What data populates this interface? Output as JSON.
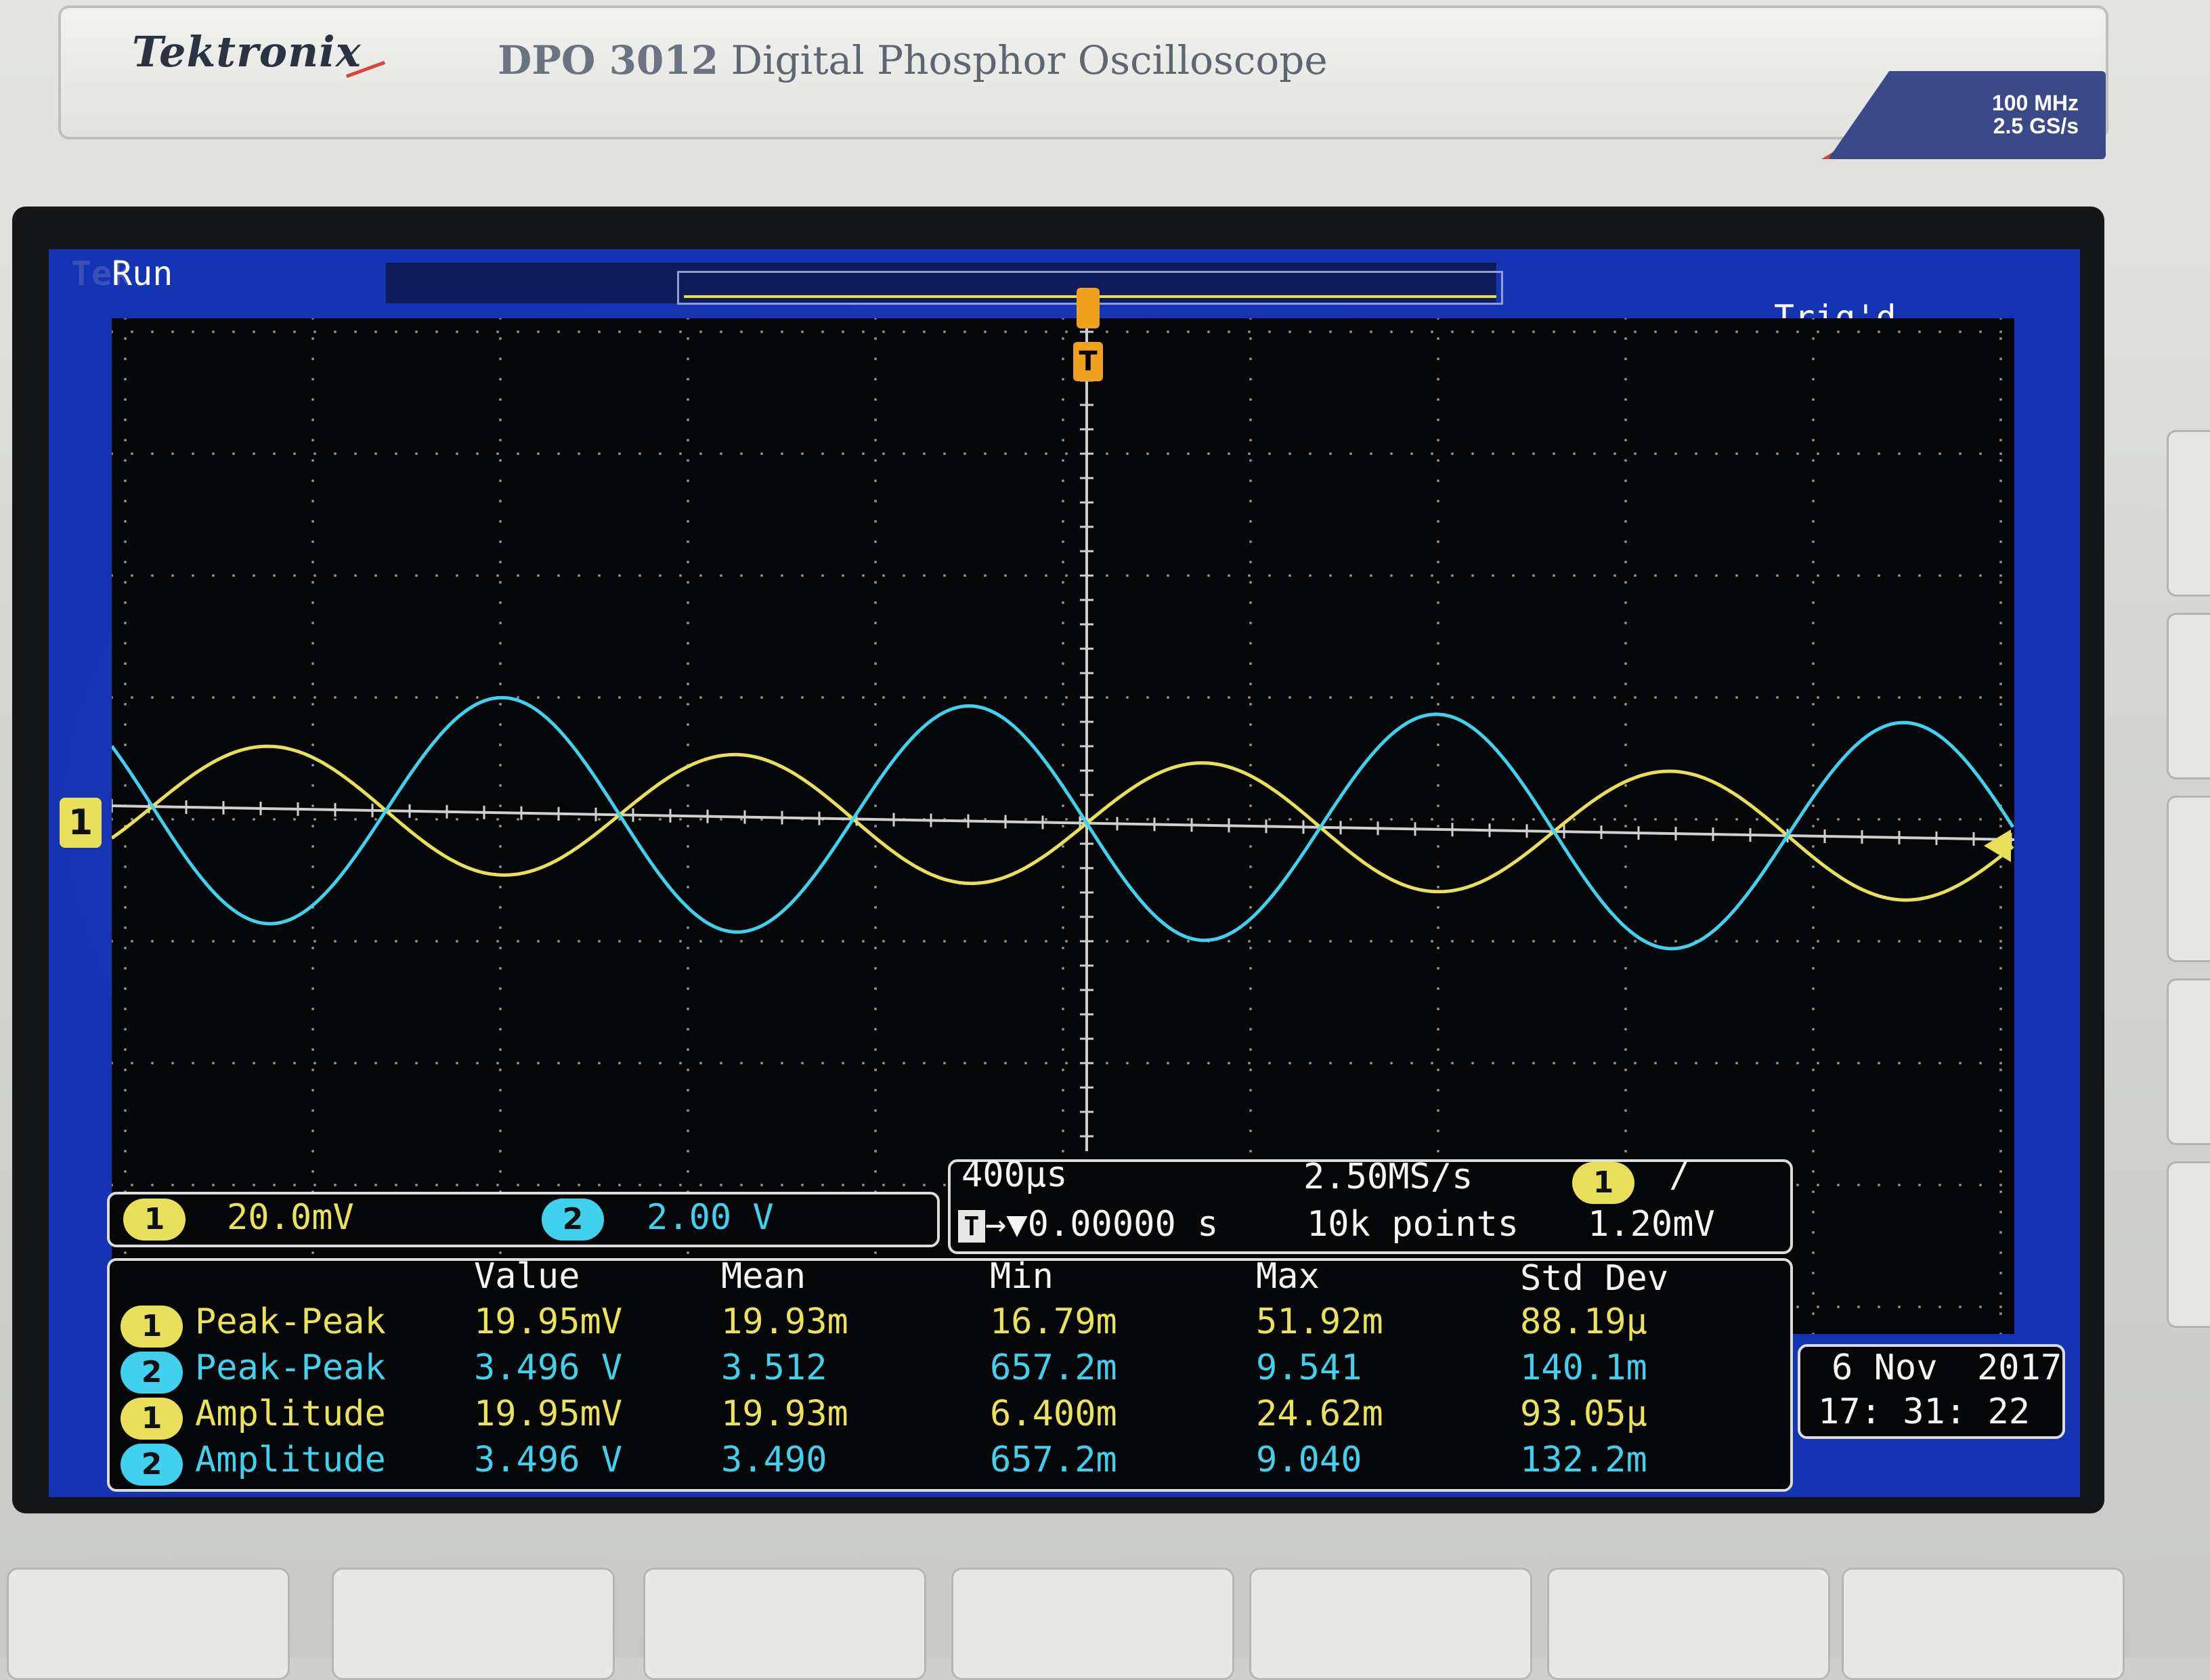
{
  "device": {
    "brand": "Tektronix",
    "model": "DPO 3012",
    "description": "Digital Phosphor Oscilloscope",
    "spec_bandwidth": "100 MHz",
    "spec_sample_rate": "2.5 GS/s"
  },
  "status": {
    "tek_label": "Tek",
    "run_state": "Run",
    "trigger_state": "Trig'd"
  },
  "channel_marker": "1",
  "trigger_marker": "T",
  "channels": [
    {
      "number": "1",
      "scale": "20.0mV",
      "color": "#e8e05a"
    },
    {
      "number": "2",
      "scale": "2.00 V",
      "color": "#41d0ee"
    }
  ],
  "timebase": {
    "time_per_div": "400µs",
    "sample_rate": "2.50MS/s",
    "record_length": "10k points",
    "trigger_position": "0.00000 s",
    "trigger_channel": "1",
    "trigger_slope": "/",
    "trigger_level": "1.20mV",
    "trigger_icon": "T"
  },
  "measurements": {
    "headers": [
      "Value",
      "Mean",
      "Min",
      "Max",
      "Std Dev"
    ],
    "rows": [
      {
        "channel": "1",
        "name": "Peak-Peak",
        "value": "19.95mV",
        "mean": "19.93m",
        "min": "16.79m",
        "max": "51.92m",
        "std": "88.19µ"
      },
      {
        "channel": "2",
        "name": "Peak-Peak",
        "value": "3.496 V",
        "mean": "3.512",
        "min": "657.2m",
        "max": "9.541",
        "std": "140.1m"
      },
      {
        "channel": "1",
        "name": "Amplitude",
        "value": "19.95mV",
        "mean": "19.93m",
        "min": "6.400m",
        "max": "24.62m",
        "std": "93.05µ"
      },
      {
        "channel": "2",
        "name": "Amplitude",
        "value": "3.496 V",
        "mean": "3.490",
        "min": "657.2m",
        "max": "9.040",
        "std": "132.2m"
      }
    ]
  },
  "datetime": {
    "date_day_month": "6 Nov",
    "year": "2017",
    "time": "17: 31: 22"
  }
}
